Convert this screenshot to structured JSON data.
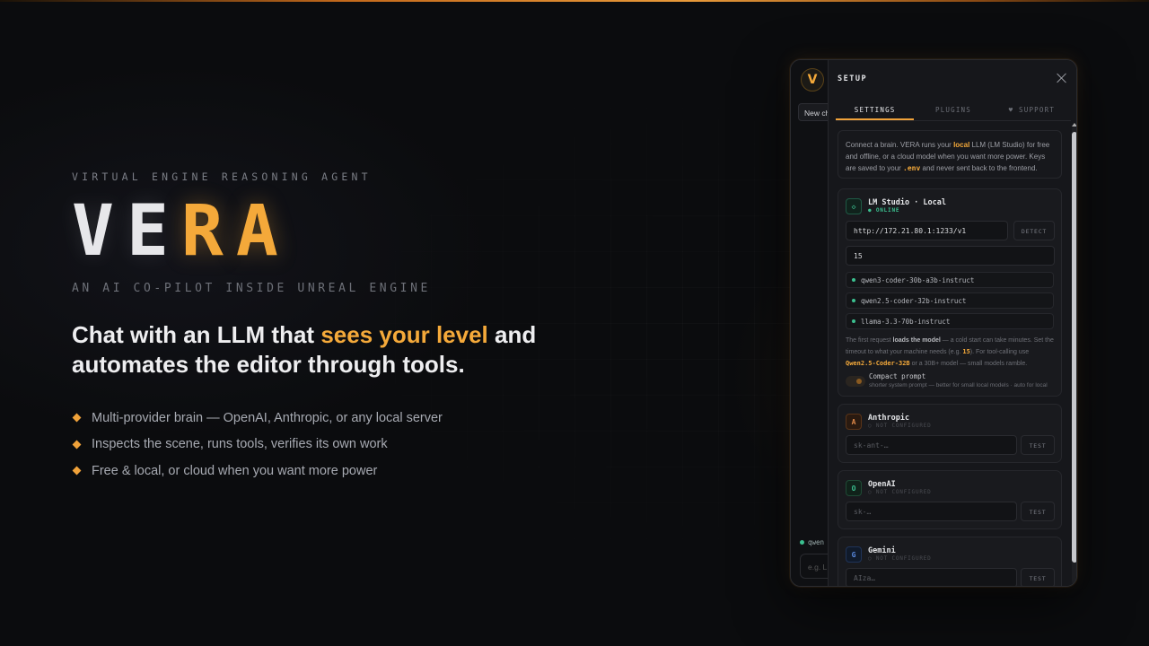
{
  "hero": {
    "eyebrow": "VIRTUAL ENGINE REASONING AGENT",
    "logo_part1": "VE",
    "logo_accent": "RA",
    "logo_part2": "",
    "subtitle": "AN AI CO-PILOT INSIDE UNREAL ENGINE",
    "headline_pre": "Chat with an LLM that ",
    "headline_highlight": "sees your level",
    "headline_post": " and automates the editor through tools.",
    "bullets": [
      "Multi-provider brain — OpenAI, Anthropic, or any local server",
      "Inspects the scene, runs tools, verifies its own work",
      "Free & local, or cloud when you want more power"
    ]
  },
  "window": {
    "logo_letter": "V",
    "new_chat": "New chat",
    "model_chip": "qwen",
    "chat_placeholder": "e.g. L",
    "panel_title": "SETUP",
    "tabs": [
      "SETTINGS",
      "PLUGINS",
      "♥ SUPPORT"
    ],
    "intro": {
      "t1": "Connect a brain. VERA runs your ",
      "local": "local",
      "t2": " LLM (LM Studio) for free and offline, or a cloud model when you want more power. Keys are saved to your ",
      "env": ".env",
      "t3": " and never sent back to the frontend."
    },
    "lmstudio": {
      "icon": "◇",
      "name": "LM Studio · Local",
      "status": "● ONLINE",
      "url": "http://172.21.80.1:1233/v1",
      "detect": "DETECT",
      "timeout": "15",
      "models": [
        "qwen3-coder-30b-a3b-instruct",
        "qwen2.5-coder-32b-instruct",
        "llama-3.3-70b-instruct"
      ],
      "note_1": "The first request ",
      "note_bold": "loads the model",
      "note_2": " — a cold start can take minutes. Set the timeout to what your machine needs (e.g. ",
      "note_hl1": "15",
      "note_3": "). For tool-calling use ",
      "note_hl2": "Qwen2.5-Coder-32B",
      "note_4": " or a 30B+ model — small models ramble.",
      "compact_label": "Compact prompt",
      "compact_sub": "shorter system prompt — better for small local models · auto for local"
    },
    "anthropic": {
      "icon": "A",
      "name": "Anthropic",
      "status": "○ NOT CONFIGURED",
      "placeholder": "sk-ant-…",
      "test": "TEST"
    },
    "openai": {
      "icon": "O",
      "name": "OpenAI",
      "status": "○ NOT CONFIGURED",
      "placeholder": "sk-…",
      "test": "TEST"
    },
    "gemini": {
      "icon": "G",
      "name": "Gemini",
      "status": "○ NOT CONFIGURED",
      "placeholder": "AIza…",
      "test": "TEST"
    }
  },
  "colors": {
    "accent": "#f4a93a",
    "online": "#3bbf8f",
    "background": "#0b0c0e"
  }
}
